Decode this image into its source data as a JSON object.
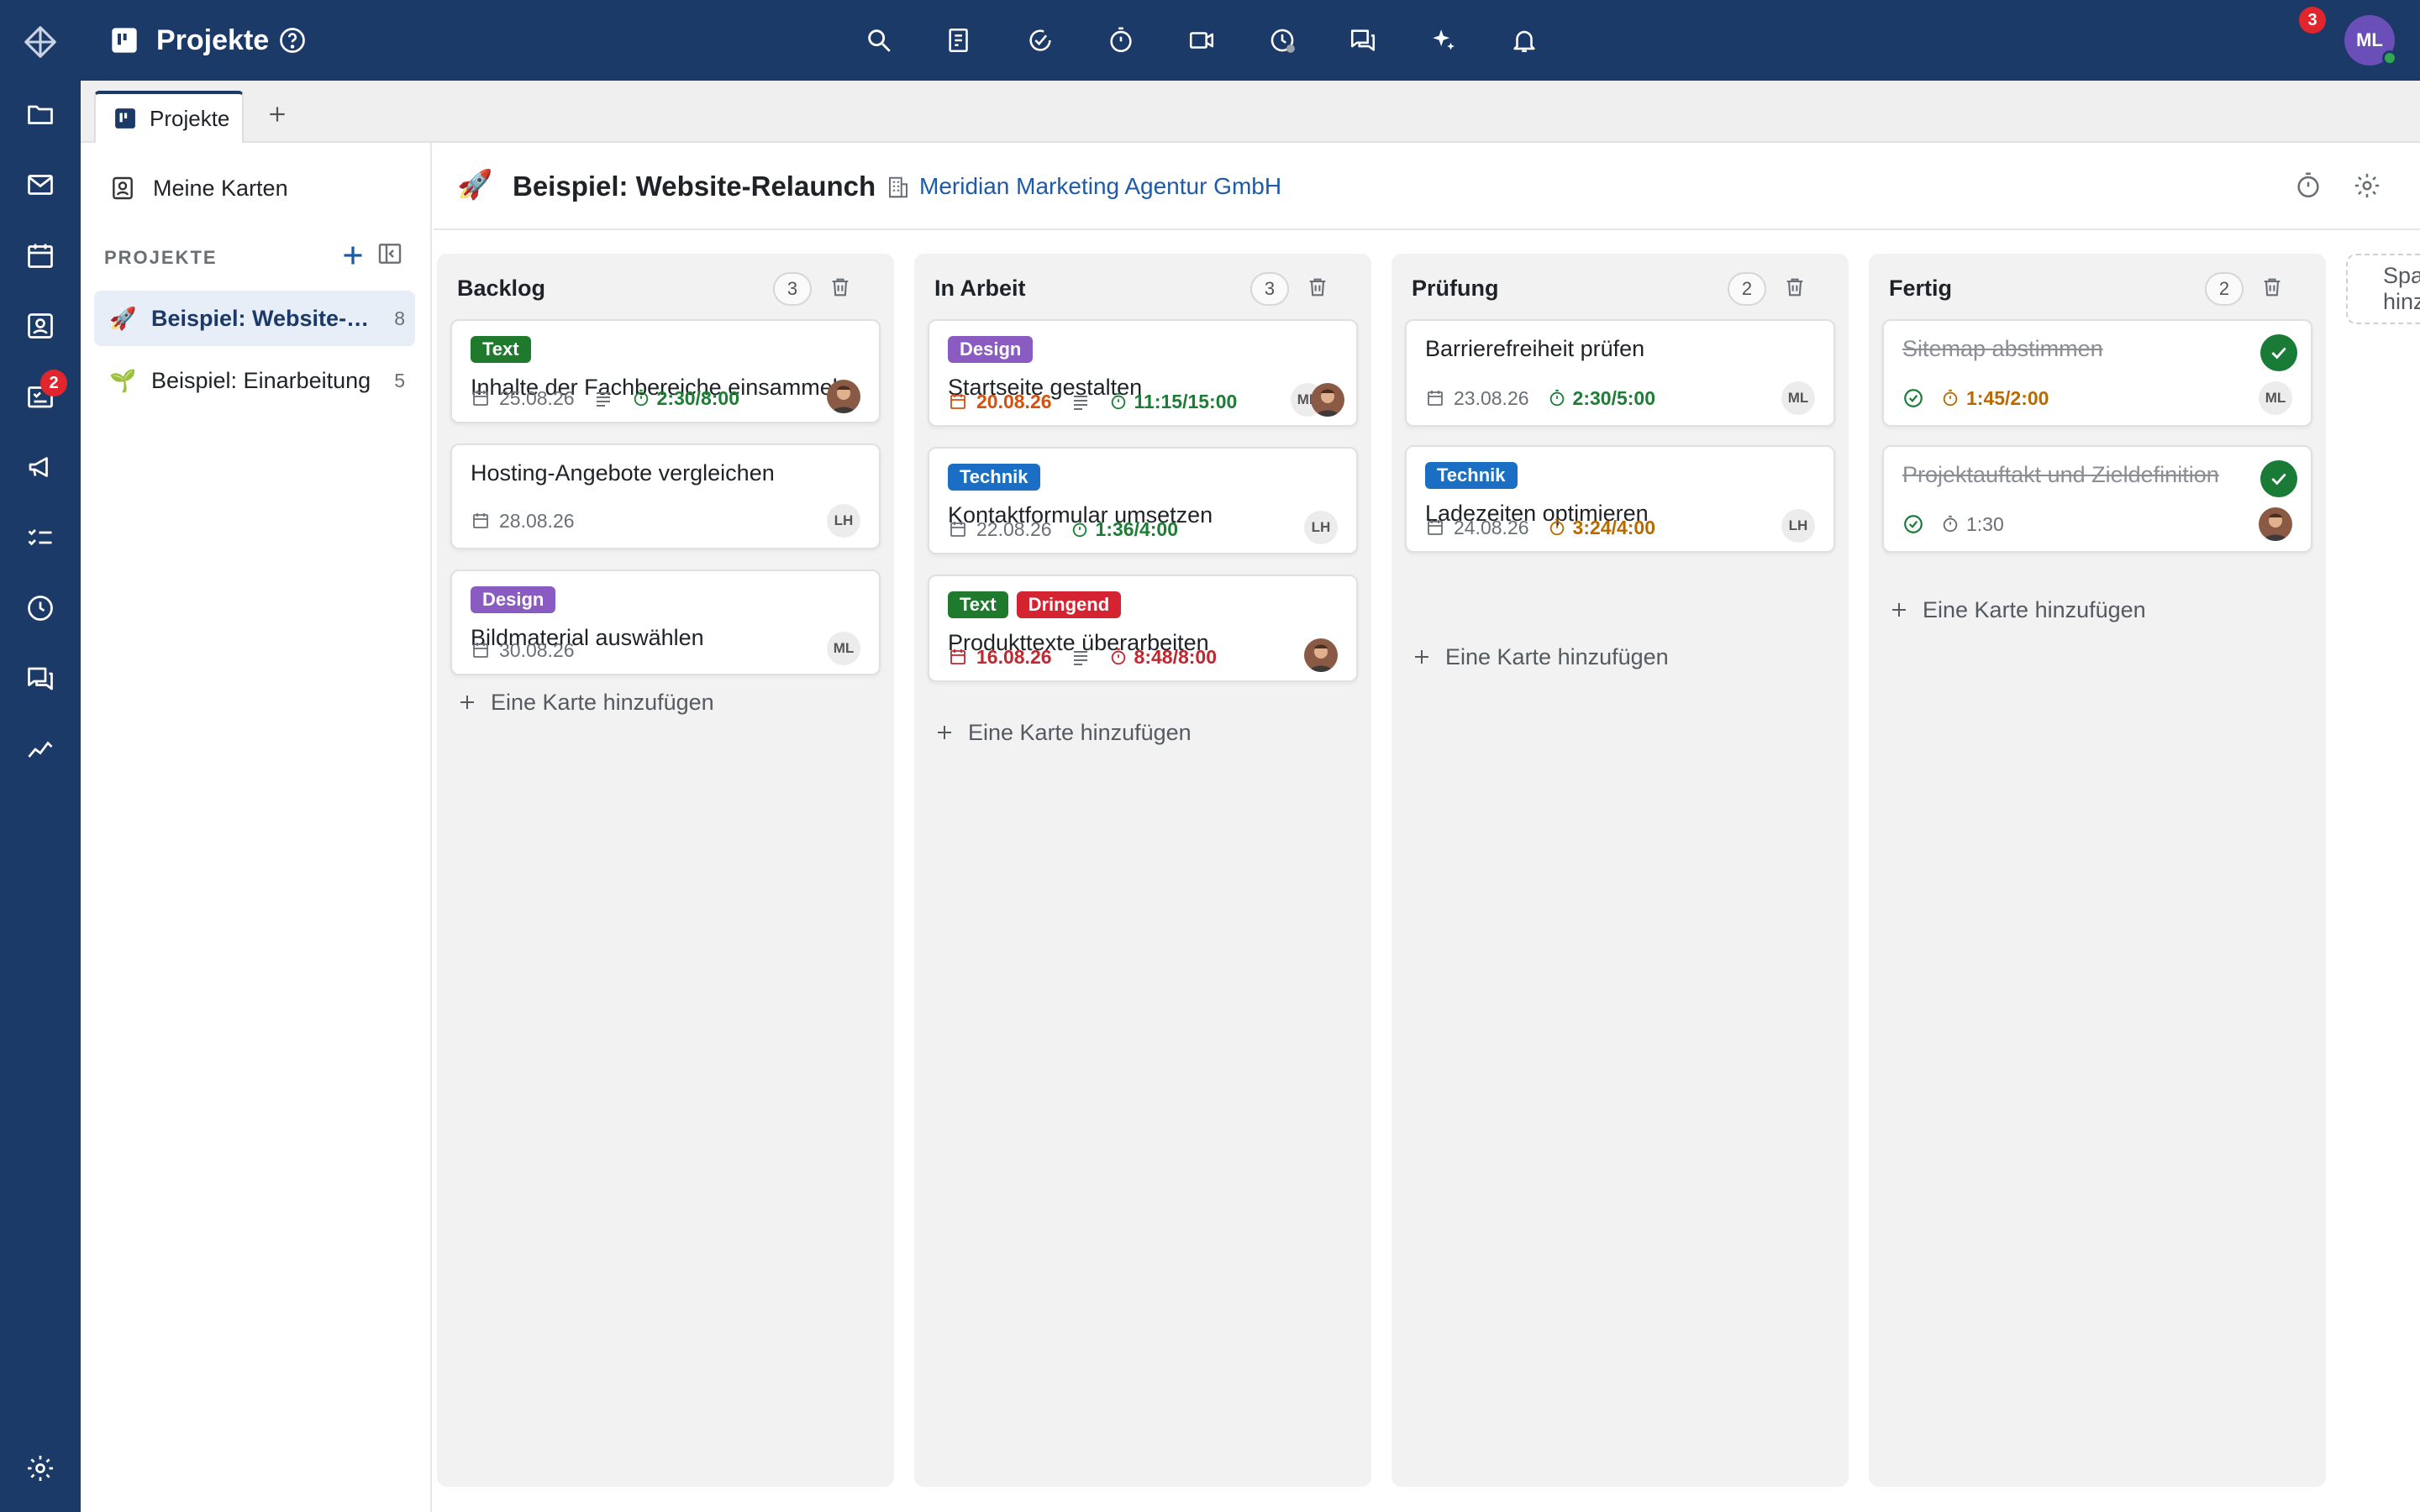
{
  "topbar": {
    "app_title": "Projekte",
    "notification_count": "3",
    "user_initials": "ML"
  },
  "rail": {
    "tasks_badge": "2"
  },
  "tabs": {
    "active_label": "Projekte"
  },
  "sidebar": {
    "my_cards": "Meine Karten",
    "section_title": "PROJEKTE",
    "projects": [
      {
        "emoji": "🚀",
        "name": "Beispiel: Website-Relaunch",
        "count": "8"
      },
      {
        "emoji": "🌱",
        "name": "Beispiel: Einarbeitung",
        "count": "5"
      }
    ]
  },
  "board": {
    "emoji": "🚀",
    "title": "Beispiel: Website-Relaunch",
    "organization": "Meridian Marketing Agentur GmbH",
    "add_card_label": "Eine Karte hinzufügen",
    "add_column_label": "Spalte hinzufügen",
    "columns": [
      {
        "title": "Backlog",
        "count": "3",
        "cards": [
          {
            "labels": [
              "Text"
            ],
            "title": "Inhalte der Fachbereiche einsammeln",
            "date": "25.08.26",
            "time": "2:30/8:00",
            "assignee": "photo"
          },
          {
            "labels": [],
            "title": "Hosting-Angebote vergleichen",
            "date": "28.08.26",
            "assignee": "LH"
          },
          {
            "labels": [
              "Design"
            ],
            "title": "Bildmaterial auswählen",
            "date": "30.08.26",
            "assignee": "ML"
          }
        ]
      },
      {
        "title": "In Arbeit",
        "count": "3",
        "cards": [
          {
            "labels": [
              "Design"
            ],
            "title": "Startseite gestalten",
            "date": "20.08.26",
            "time": "11:15/15:00",
            "assignee": "ML"
          },
          {
            "labels": [
              "Technik"
            ],
            "title": "Kontaktformular umsetzen",
            "date": "22.08.26",
            "time": "1:36/4:00",
            "assignee": "LH"
          },
          {
            "labels": [
              "Text",
              "Dringend"
            ],
            "title": "Produkttexte überarbeiten",
            "date": "16.08.26",
            "time": "8:48/8:00",
            "assignee": "photo"
          }
        ]
      },
      {
        "title": "Prüfung",
        "count": "2",
        "cards": [
          {
            "labels": [],
            "title": "Barrierefreiheit prüfen",
            "date": "23.08.26",
            "time": "2:30/5:00",
            "assignee": "ML"
          },
          {
            "labels": [
              "Technik"
            ],
            "title": "Ladezeiten optimieren",
            "date": "24.08.26",
            "time": "3:24/4:00",
            "assignee": "LH"
          }
        ]
      },
      {
        "title": "Fertig",
        "count": "2",
        "cards": [
          {
            "labels": [],
            "title": "Sitemap abstimmen",
            "time": "1:45/2:00",
            "assignee": "ML",
            "done": true
          },
          {
            "labels": [],
            "title": "Projektauftakt und Zieldefinition",
            "time": "1:30",
            "assignee": "photo",
            "done": true
          }
        ]
      }
    ]
  },
  "colors": {
    "nav_bg": "#1c3a68",
    "label_text": "#1f7a2e",
    "label_design": "#8a5cc2",
    "label_technik": "#1a6fc4",
    "label_dringend": "#d42331",
    "done_check": "#1a7b36"
  },
  "icons": [
    "logo-icon",
    "folder-icon",
    "mail-icon",
    "calendar-icon",
    "contacts-icon",
    "tasks-icon",
    "megaphone-icon",
    "checklist-icon",
    "clock-icon",
    "chat-icon",
    "analytics-icon",
    "settings-icon",
    "search-icon",
    "note-icon",
    "check-plus-icon",
    "timer-icon",
    "video-icon",
    "history-icon",
    "messages-icon",
    "sparkle-icon",
    "bell-icon"
  ]
}
